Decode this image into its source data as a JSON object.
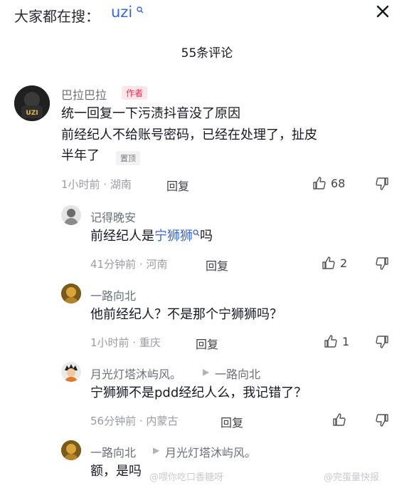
{
  "header": {
    "search_label": "大家都在搜：",
    "search_keyword": "uzi",
    "title": "55条评论"
  },
  "comments": [
    {
      "user": "巴拉巴拉",
      "author_badge": "作者",
      "text_lines": [
        "统一回复一下污渍抖音没了原因",
        "前经纪人不给账号密码，已经在处理了，扯皮",
        "半年了"
      ],
      "pinned_badge": "置顶",
      "meta": "1小时前 · 湖南",
      "reply_label": "回复",
      "likes": "68"
    },
    {
      "user": "记得晚安",
      "text_pre": "前经纪人是",
      "text_link": "宁狮狮",
      "text_post": "吗",
      "meta": "41分钟前 · 河南",
      "reply_label": "回复",
      "likes": "2"
    },
    {
      "user": "一路向北",
      "text": "他前经纪人？不是那个宁狮狮吗？",
      "meta": "1小时前 · 重庆",
      "reply_label": "回复",
      "likes": "1"
    },
    {
      "user": "月光灯塔沐屿风。",
      "reply_to": "一路向北",
      "text": "宁狮狮不是pdd经纪人么，我记错了？",
      "meta": "56分钟前 · 内蒙古",
      "reply_label": "回复"
    },
    {
      "user": "一路向北",
      "reply_to": "月光灯塔沐屿风。",
      "text": "额，是吗"
    }
  ],
  "watermarks": [
    "@喂你吃口香糖呀",
    "@完蛋量快报"
  ],
  "colors": {
    "link": "#3867d6",
    "author_badge": "#fe2c55"
  }
}
